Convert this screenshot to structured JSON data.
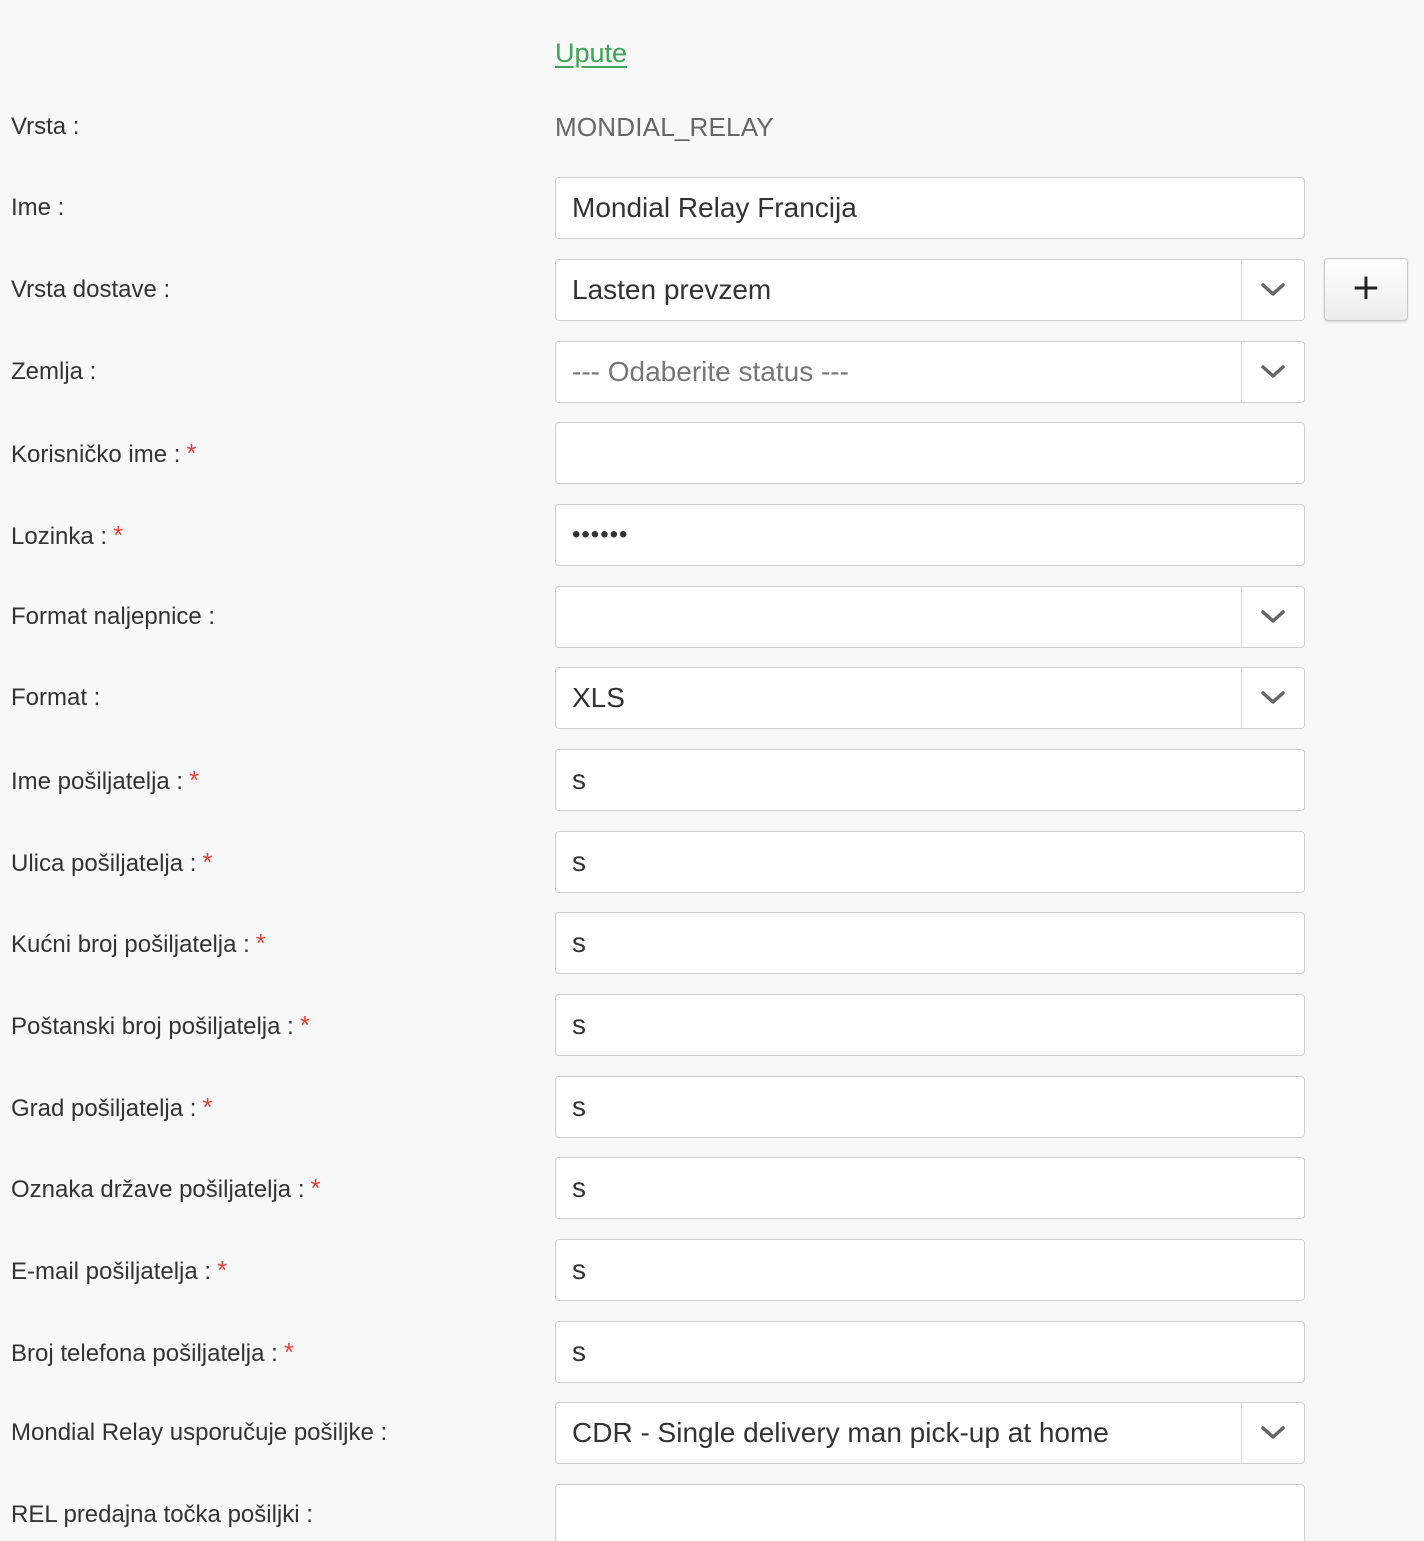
{
  "instructions_link": "Upute",
  "fields": [
    {
      "label": "Vrsta :",
      "value": "MONDIAL_RELAY"
    },
    {
      "label": "Ime :",
      "value": "Mondial Relay Francija"
    },
    {
      "label": "Vrsta dostave :",
      "value": "Lasten prevzem",
      "add_button": "+"
    },
    {
      "label": "Zemlja :",
      "placeholder": "--- Odaberite status ---"
    },
    {
      "label": "Korisničko ime :",
      "required": "*",
      "value": ""
    },
    {
      "label": "Lozinka :",
      "required": "*",
      "value": "••••••"
    },
    {
      "label": "Format naljepnice :",
      "value": ""
    },
    {
      "label": "Format :",
      "value": "XLS"
    },
    {
      "label": "Ime pošiljatelja :",
      "required": "*",
      "value": "s"
    },
    {
      "label": "Ulica pošiljatelja :",
      "required": "*",
      "value": "s"
    },
    {
      "label": "Kućni broj pošiljatelja :",
      "required": "*",
      "value": "s"
    },
    {
      "label": "Poštanski broj pošiljatelja :",
      "required": "*",
      "value": "s"
    },
    {
      "label": "Grad pošiljatelja :",
      "required": "*",
      "value": "s"
    },
    {
      "label": "Oznaka države pošiljatelja :",
      "required": "*",
      "value": "s"
    },
    {
      "label": "E-mail pošiljatelja :",
      "required": "*",
      "value": "s"
    },
    {
      "label": "Broj telefona pošiljatelja :",
      "required": "*",
      "value": "s"
    },
    {
      "label": "Mondial Relay usporučuje pošiljke :",
      "value": "CDR - Single delivery man pick-up at home"
    },
    {
      "label": "REL predajna točka pošiljki :",
      "value": ""
    }
  ],
  "colors": {
    "link": "#3aa655",
    "required": "#e0443a",
    "background": "#f8f8f8",
    "field_border": "#cfcfcf"
  },
  "icons": {
    "select_arrow": "chevron-down-icon",
    "add": "plus-icon"
  }
}
